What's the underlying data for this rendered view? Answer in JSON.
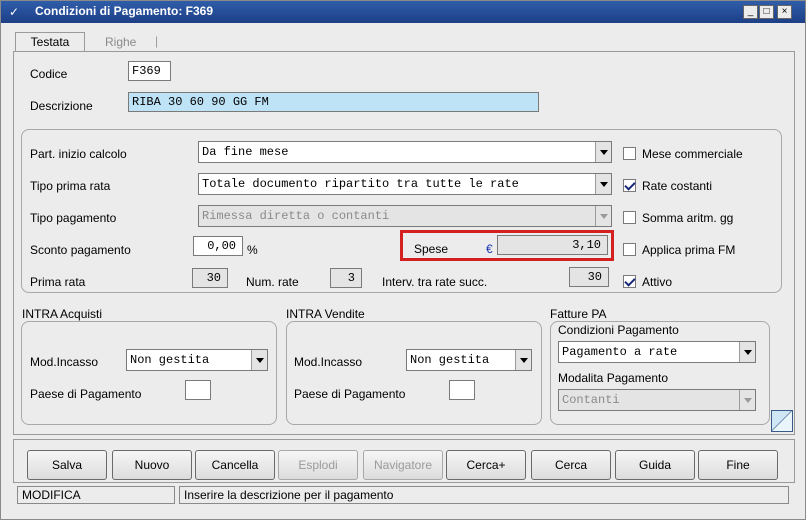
{
  "window": {
    "title": "Condizioni di Pagamento: F369"
  },
  "tabs": [
    {
      "label": "Testata"
    },
    {
      "label": "Righe"
    }
  ],
  "codice": {
    "label": "Codice",
    "value": "F369"
  },
  "descrizione": {
    "label": "Descrizione",
    "value": "RIBA 30 60 90 GG FM"
  },
  "calcolo": {
    "part_inizio_label": "Part. inizio calcolo",
    "part_inizio_value": "Da fine mese",
    "tipo_prima_rata_label": "Tipo prima rata",
    "tipo_prima_rata_value": "Totale documento ripartito tra tutte le rate",
    "tipo_pagamento_label": "Tipo pagamento",
    "tipo_pagamento_value": "Rimessa diretta o contanti",
    "sconto_label": "Sconto pagamento",
    "sconto_value": "0,00",
    "sconto_unit": "%",
    "spese_label": "Spese",
    "spese_currency": "€",
    "spese_value": "3,10",
    "prima_rata_label": "Prima rata",
    "prima_rata_value": "30",
    "num_rate_label": "Num. rate",
    "num_rate_value": "3",
    "interv_label": "Interv. tra rate succ.",
    "interv_value": "30"
  },
  "checkboxes": {
    "mese_commerciale": {
      "label": "Mese commerciale",
      "checked": false
    },
    "rate_costanti": {
      "label": "Rate costanti",
      "checked": true
    },
    "somma_aritm": {
      "label": "Somma aritm. gg",
      "checked": false
    },
    "applica_prima_fm": {
      "label": "Applica prima FM",
      "checked": false
    },
    "attivo": {
      "label": "Attivo",
      "checked": true
    }
  },
  "intra_acquisti": {
    "title": "INTRA Acquisti",
    "mod_incasso_label": "Mod.Incasso",
    "mod_incasso_value": "Non gestita",
    "paese_label": "Paese di Pagamento",
    "paese_value": ""
  },
  "intra_vendite": {
    "title": "INTRA Vendite",
    "mod_incasso_label": "Mod.Incasso",
    "mod_incasso_value": "Non gestita",
    "paese_label": "Paese di Pagamento",
    "paese_value": ""
  },
  "fatture_pa": {
    "title": "Fatture PA",
    "condizioni_label": "Condizioni Pagamento",
    "condizioni_value": "Pagamento a rate",
    "modalita_label": "Modalita Pagamento",
    "modalita_value": "Contanti"
  },
  "buttons": {
    "salva": "Salva",
    "nuovo": "Nuovo",
    "cancella": "Cancella",
    "esplodi": "Esplodi",
    "navigatore": "Navigatore",
    "cerca_plus": "Cerca+",
    "cerca": "Cerca",
    "guida": "Guida",
    "fine": "Fine"
  },
  "status": {
    "mode": "MODIFICA",
    "hint": "Inserire la descrizione per il pagamento"
  },
  "colors": {
    "title_bar": "#1d3f87",
    "highlight": "#d32020",
    "selected_field": "#bfe3f6",
    "euro": "#1a36b0"
  }
}
